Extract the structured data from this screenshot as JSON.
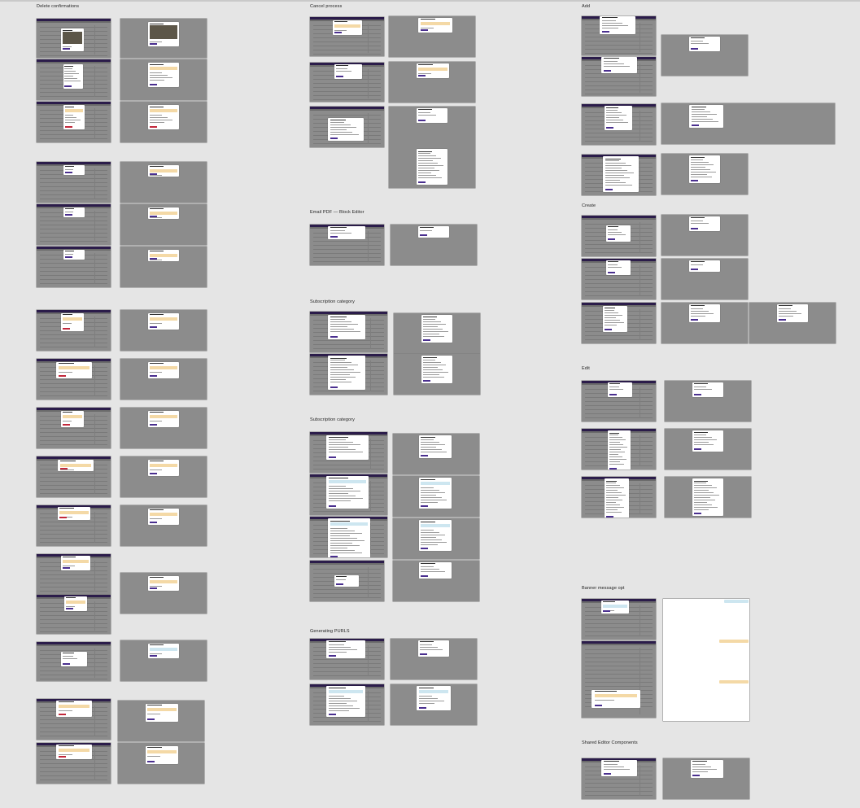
{
  "canvas": {
    "background": "#e5e5e5",
    "frame_color": "#8c8c8c",
    "header_color": "#2b1c4a",
    "primary_button_color": "#4a2f8f",
    "danger_button_color": "#c2283b",
    "warning_color": "#f4d9a6",
    "info_color": "#cde6f0"
  },
  "sections": [
    {
      "id": "delete",
      "title": "Delete confirmations"
    },
    {
      "id": "cancel",
      "title": "Cancel process"
    },
    {
      "id": "add",
      "title": "Add"
    },
    {
      "id": "email-pdf",
      "title": "Email PDF — Block Editor"
    },
    {
      "id": "subcat-1",
      "title": "Subscription category"
    },
    {
      "id": "subcat-2",
      "title": "Subscription category"
    },
    {
      "id": "purls",
      "title": "Generating PURLS"
    },
    {
      "id": "create",
      "title": "Create"
    },
    {
      "id": "edit",
      "title": "Edit"
    },
    {
      "id": "banner",
      "title": "Banner message opt"
    },
    {
      "id": "shared",
      "title": "Shared Editor Components"
    }
  ]
}
